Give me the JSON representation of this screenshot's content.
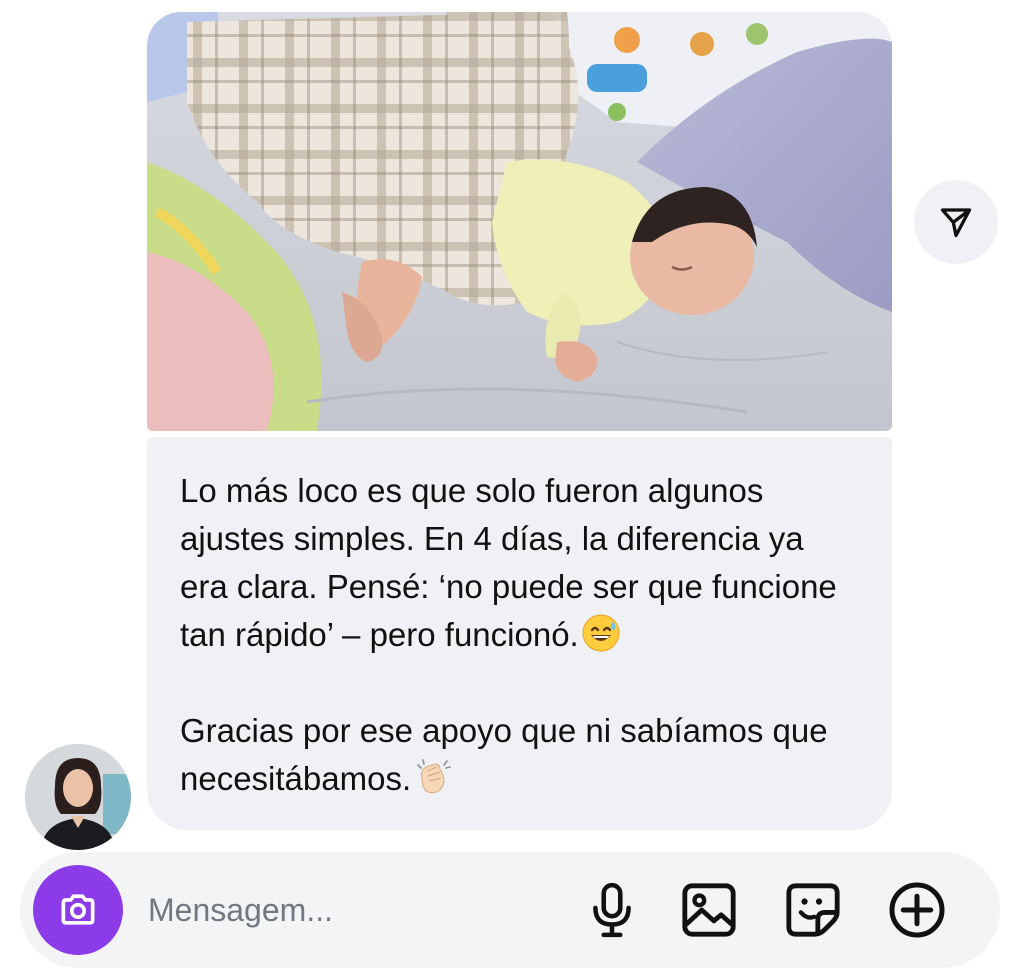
{
  "message": {
    "paragraph_1": "Lo más loco es que solo fueron algunos ajustes simples. En 4 días, la diferencia ya era clara. Pensé: ‘no puede ser que funcione tan rápido’ – pero funcionó.",
    "paragraph_2": "Gracias por ese apoyo que ni sabíamos que necesitábamos.",
    "emoji_1": "sweat-smile-emoji",
    "emoji_2": "clapping-hands-emoji"
  },
  "composer": {
    "placeholder": "Mensagem..."
  },
  "icons": {
    "share": "send-icon",
    "camera": "camera-icon",
    "microphone": "microphone-icon",
    "gallery": "gallery-icon",
    "sticker": "sticker-icon",
    "more": "plus-circle-icon"
  },
  "colors": {
    "camera_button": "#8c3be8",
    "bubble_background": "#eff1f4",
    "composer_background": "#f3f4f6"
  }
}
